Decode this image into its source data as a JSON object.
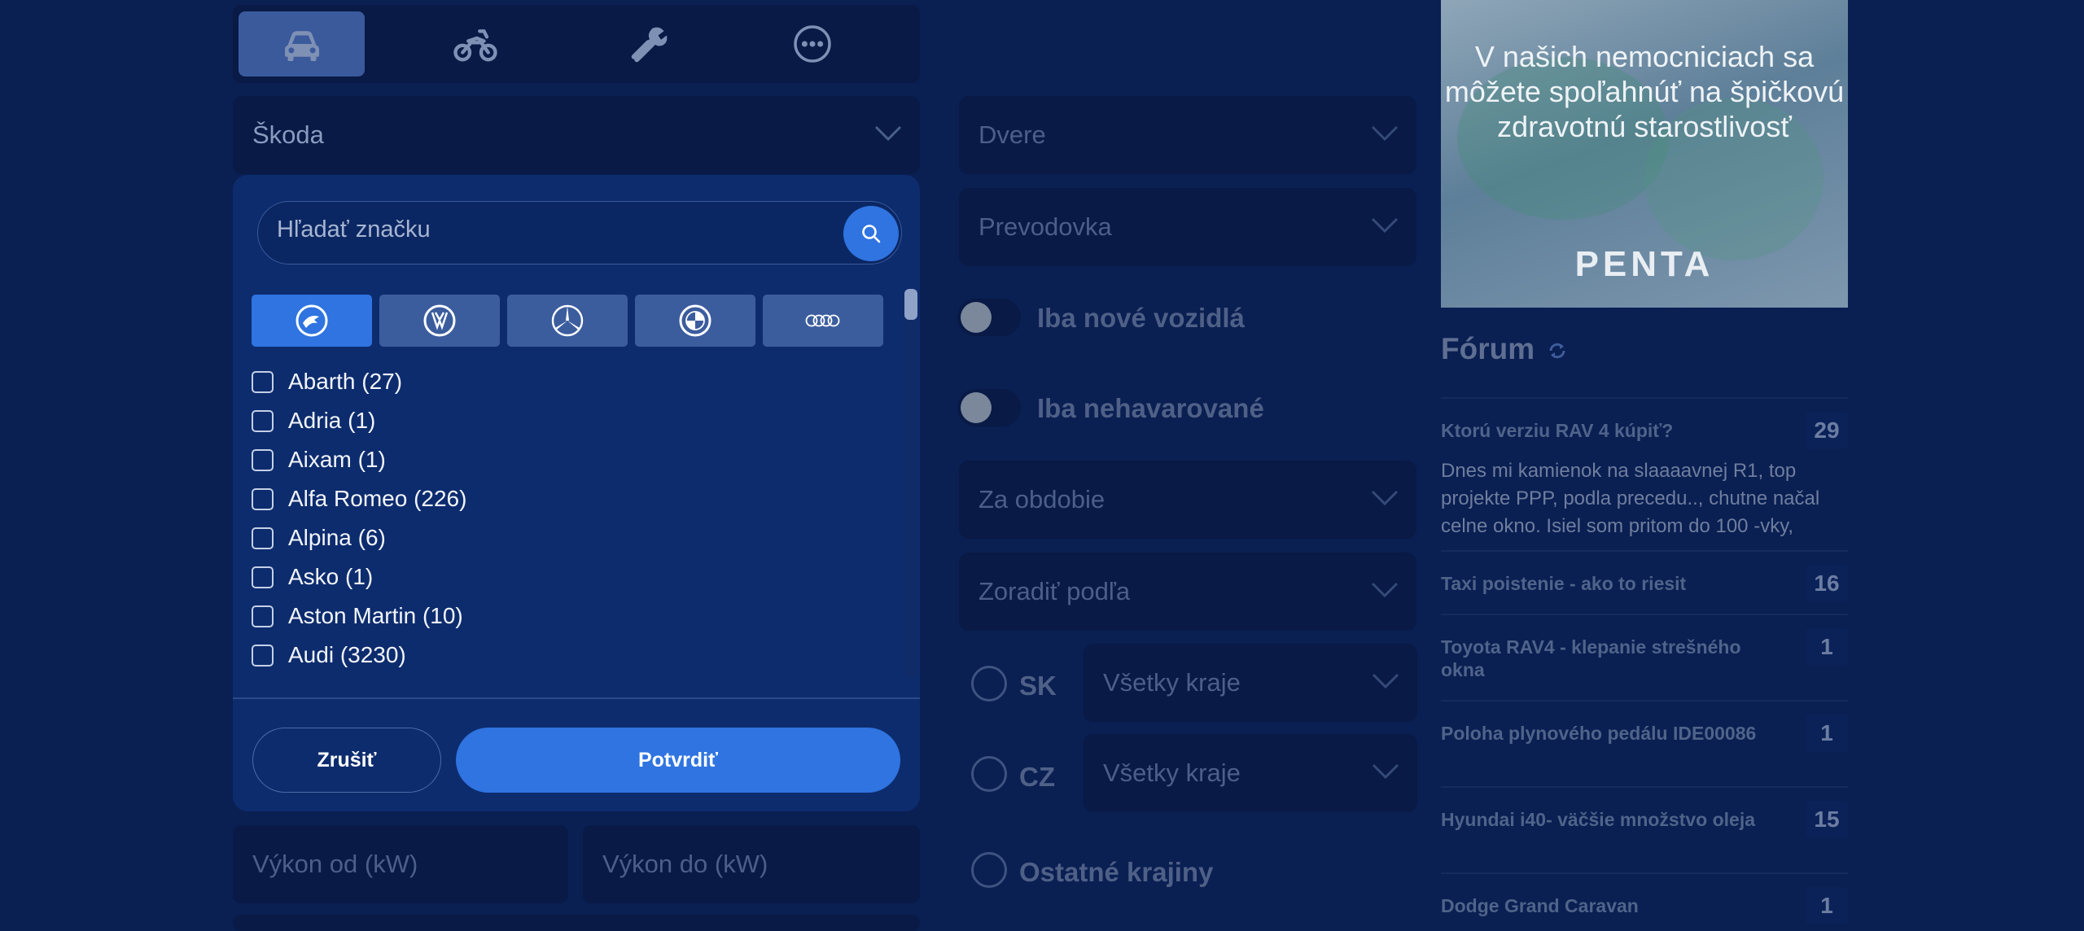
{
  "vehicle_tabs": [
    {
      "icon": "car-icon"
    },
    {
      "icon": "motorcycle-icon"
    },
    {
      "icon": "tools-icon"
    },
    {
      "icon": "more-icon"
    }
  ],
  "brand_select": {
    "value": "Škoda"
  },
  "brand_search": {
    "placeholder": "Hľadať značku",
    "button_icon": "search-icon"
  },
  "brand_logos": [
    "skoda-logo-icon",
    "volkswagen-logo-icon",
    "mercedes-logo-icon",
    "bmw-logo-icon",
    "audi-logo-icon"
  ],
  "brands": [
    {
      "label": "Abarth (27)"
    },
    {
      "label": "Adria (1)"
    },
    {
      "label": "Aixam (1)"
    },
    {
      "label": "Alfa Romeo (226)"
    },
    {
      "label": "Alpina (6)"
    },
    {
      "label": "Asko (1)"
    },
    {
      "label": "Aston Martin (10)"
    },
    {
      "label": "Audi (3230)"
    }
  ],
  "buttons": {
    "cancel": "Zrušiť",
    "confirm": "Potvrdiť"
  },
  "power": {
    "from": "Výkon od (kW)",
    "to": "Výkon do (kW)"
  },
  "filters": {
    "doors": "Dvere",
    "transmission": "Prevodovka",
    "new_only": "Iba nové vozidlá",
    "undamaged_only": "Iba nehavarované",
    "period": "Za obdobie",
    "sort": "Zoradiť podľa",
    "sk": "SK",
    "sk_region": "Všetky kraje",
    "cz": "CZ",
    "cz_region": "Všetky kraje",
    "other": "Ostatné krajiny"
  },
  "ad": {
    "text": "V našich nemocniciach sa môžete spoľahnúť na špičkovú zdravotnú starostlivosť",
    "brand": "PENTA"
  },
  "forum": {
    "title": "Fórum",
    "refresh_icon": "refresh-icon",
    "topics": [
      {
        "title": "Ktorú verziu RAV 4 kúpiť?",
        "count": "29",
        "excerpt": "Dnes mi kamienok na slaaaavnej R1, top projekte PPP, podla precedu.., chutne načal celne okno. Isiel som pritom do 100 -vky,"
      },
      {
        "title": "Taxi poistenie - ako to riesit",
        "count": "16"
      },
      {
        "title": "Toyota RAV4 - klepanie strešného okna",
        "count": "1"
      },
      {
        "title": "Poloha plynového pedálu IDE00086",
        "count": "1"
      },
      {
        "title": "Hyundai i40- väčšie množstvo oleja",
        "count": "15"
      },
      {
        "title": "Dodge Grand Caravan",
        "count": "1"
      }
    ]
  },
  "colors": {
    "accent": "#2f74e0",
    "background": "#0a1f52",
    "panel": "#0d2c6e",
    "field": "#081a45"
  }
}
